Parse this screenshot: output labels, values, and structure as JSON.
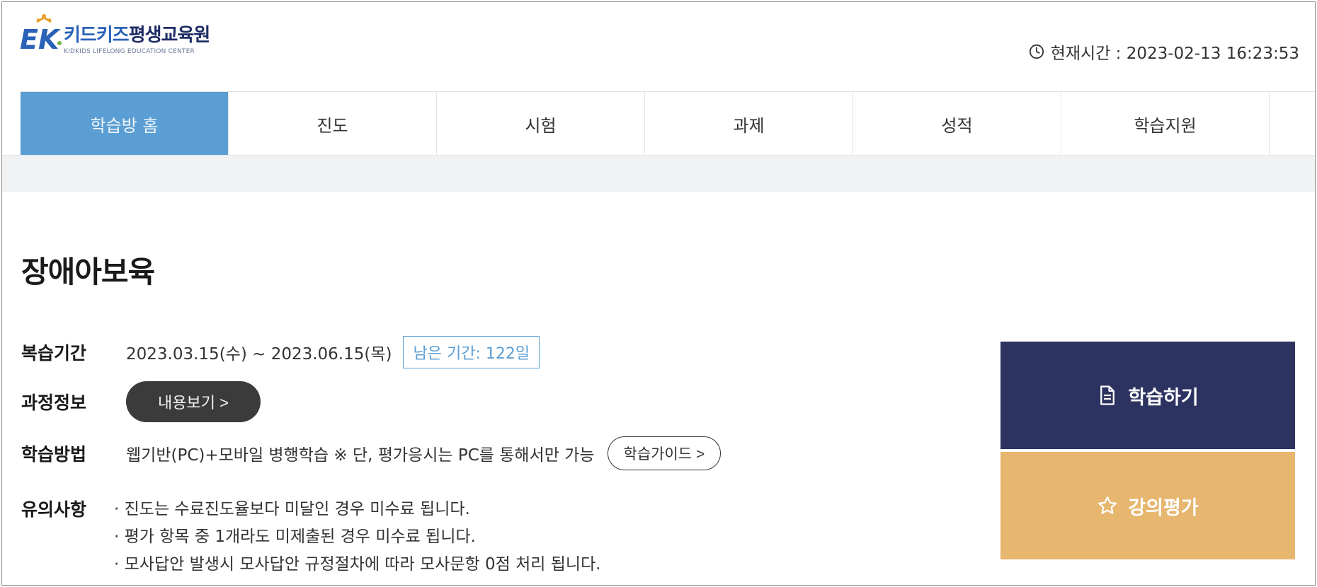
{
  "header": {
    "brand": {
      "mark": "EK",
      "title_part1": "키드키즈",
      "title_part2": "평생교육원",
      "subtitle": "KIDKIDS LIFELONG EDUCATION CENTER"
    },
    "clock": {
      "label": "현재시간 : 2023-02-13 16:23:53",
      "icon": "clock-icon"
    }
  },
  "nav": {
    "items": [
      {
        "label": "학습방 홈",
        "active": true
      },
      {
        "label": "진도",
        "active": false
      },
      {
        "label": "시험",
        "active": false
      },
      {
        "label": "과제",
        "active": false
      },
      {
        "label": "성적",
        "active": false
      },
      {
        "label": "학습지원",
        "active": false
      }
    ]
  },
  "course": {
    "title": "장애아보육",
    "review": {
      "label": "복습기간",
      "period": "2023.03.15(수) ~ 2023.06.15(목)",
      "remaining": "남은 기간: 122일"
    },
    "info": {
      "label": "과정정보",
      "button": "내용보기 >"
    },
    "method": {
      "label": "학습방법",
      "text": "웹기반(PC)+모바일 병행학습 ※ 단, 평가응시는 PC를 통해서만 가능",
      "guide_button": "학습가이드 >"
    },
    "notes": {
      "label": "유의사항",
      "lines": [
        "· 진도는 수료진도율보다 미달인 경우 미수료 됩니다.",
        "· 평가 항목 중 1개라도 미제출된 경우 미수료 됩니다.",
        "· 모사답안 발생시 모사답안 규정절차에 따라 모사문항 0점 처리 됩니다."
      ]
    }
  },
  "actions": {
    "study": {
      "label": "학습하기",
      "icon": "document-icon",
      "color": "#2c3360"
    },
    "evaluate": {
      "label": "강의평가",
      "icon": "star-icon",
      "color": "#e7b66f"
    }
  },
  "colors": {
    "nav_active": "#5b9ed3",
    "brand_blue": "#2a62b7"
  }
}
